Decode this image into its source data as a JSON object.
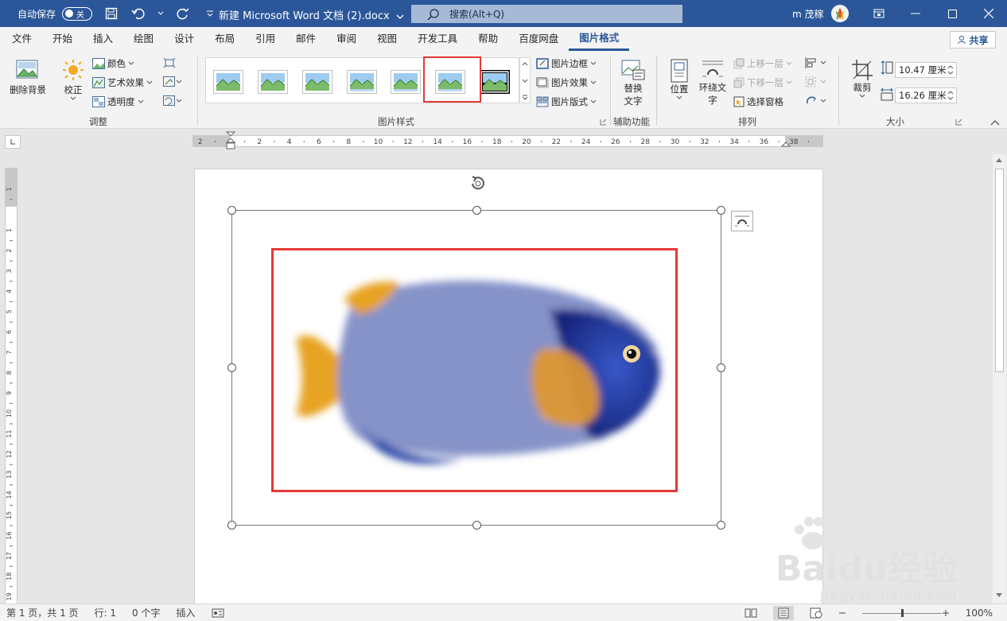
{
  "titlebar": {
    "autosave_label": "自动保存",
    "autosave_state": "关",
    "doc_title": "新建 Microsoft Word 文档 (2).docx",
    "search_placeholder": "搜索(Alt+Q)",
    "user_name": "m 茂稼",
    "bg_color": "#2b579a"
  },
  "tabs": [
    {
      "label": "文件"
    },
    {
      "label": "开始"
    },
    {
      "label": "插入"
    },
    {
      "label": "绘图"
    },
    {
      "label": "设计"
    },
    {
      "label": "布局"
    },
    {
      "label": "引用"
    },
    {
      "label": "邮件"
    },
    {
      "label": "审阅"
    },
    {
      "label": "视图"
    },
    {
      "label": "开发工具"
    },
    {
      "label": "帮助"
    },
    {
      "label": "百度网盘"
    },
    {
      "label": "图片格式",
      "active": true
    }
  ],
  "share_label": "共享",
  "ribbon": {
    "remove_bg": "删除背景",
    "correct": "校正",
    "color": "颜色",
    "art_effects": "艺术效果",
    "transparency": "透明度",
    "group_adjust": "调整",
    "group_styles": "图片样式",
    "picture_border": "图片边框",
    "picture_effects": "图片效果",
    "picture_layout": "图片版式",
    "alt_text_line1": "替换",
    "alt_text_line2": "文字",
    "group_accessibility": "辅助功能",
    "position": "位置",
    "wrap_text_line1": "环绕文",
    "wrap_text_line2": "字",
    "bring_forward": "上移一层",
    "send_backward": "下移一层",
    "selection_pane": "选择窗格",
    "group_arrange": "排列",
    "crop": "裁剪",
    "height": "10.47 厘米",
    "width": "16.26 厘米",
    "group_size": "大小",
    "selected_style_index": 5
  },
  "ruler": {
    "labels": [
      "2",
      "2",
      "4",
      "6",
      "8",
      "10",
      "12",
      "14",
      "16",
      "18",
      "20",
      "22",
      "24",
      "26",
      "28",
      "30",
      "32",
      "34",
      "36",
      "38"
    ],
    "vlabels": [
      "1",
      "1",
      "2",
      "3",
      "4",
      "5",
      "6",
      "7",
      "8",
      "9",
      "10",
      "11",
      "12",
      "13",
      "14",
      "15",
      "16",
      "17",
      "18",
      "19"
    ]
  },
  "statusbar": {
    "page": "第 1 页，共 1 页",
    "line": "行: 1",
    "words": "0 个字",
    "mode": "插入",
    "zoom": "100%"
  },
  "watermark": {
    "brand": "Baidu经验",
    "url": "jingyan.baidu.com"
  },
  "colors": {
    "highlight": "#e53935",
    "accent": "#2b579a"
  }
}
